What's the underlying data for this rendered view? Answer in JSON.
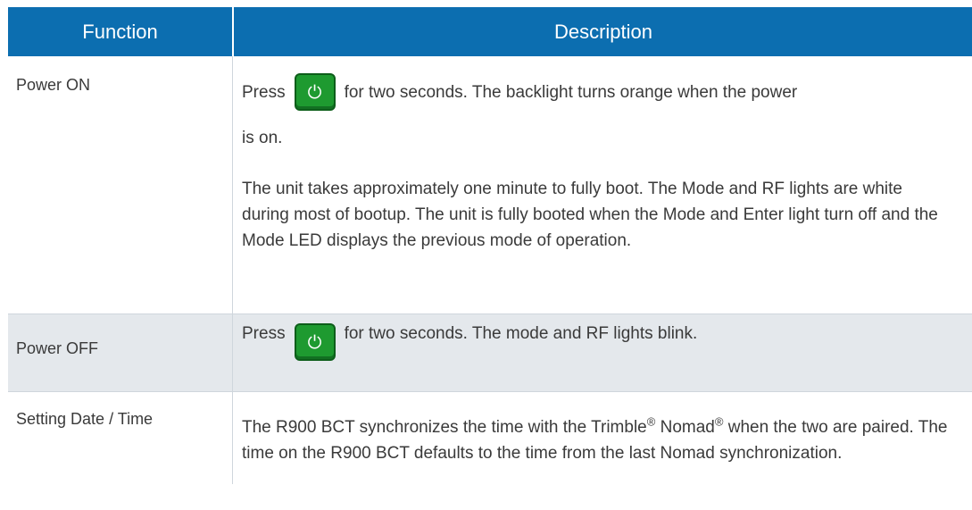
{
  "header": {
    "function": "Function",
    "description": "Description"
  },
  "rows": [
    {
      "function": "Power ON",
      "desc_press": "Press",
      "desc_after_icon": "for two seconds. The backlight turns orange when the power",
      "desc_line2": "is on.",
      "desc_para2": "The unit takes approximately one minute to fully boot. The Mode and RF lights are white during most of bootup. The unit is fully booted when the Mode and Enter light turn off and the Mode LED displays the previous mode of operation."
    },
    {
      "function": "Power OFF",
      "desc_press": "Press",
      "desc_after_icon": "for two seconds. The mode and RF lights blink."
    },
    {
      "function": "Setting Date / Time",
      "desc_part1": "The R900 BCT synchronizes the time with the Trimble",
      "desc_reg1": "®",
      "desc_part2": " Nomad",
      "desc_reg2": "®",
      "desc_part3": " when the two are paired. The time on the R900 BCT defaults to the time from the last Nomad synchronization."
    }
  ],
  "icons": {
    "power": "power-icon"
  },
  "colors": {
    "header_bg": "#0c6eb0",
    "alt_row_bg": "#e4e8ec",
    "button_green": "#1e9a30"
  }
}
